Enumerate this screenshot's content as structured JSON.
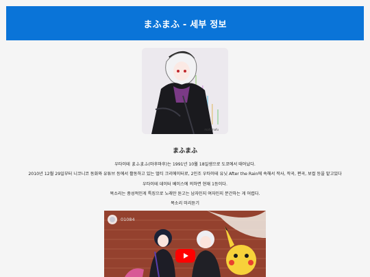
{
  "header": {
    "title": "まふまふ - 세부 정보"
  },
  "profile": {
    "name": "まふまふ",
    "image_caption": "mafumafu"
  },
  "description": {
    "line1": "우타이테 まふまふ(마후마후)는 1991년 10월 18일생으로 도쿄에서 태어났다.",
    "line2": "2010년 12월 29일부터 니코니코 동화와 유튜브 등에서 활동하고 있는 멀티 크리에이터로, 2인조 우타이테 유닛 After the Rain에 속해서 작사, 작곡, 편곡, 보컬 등을 맡고있다",
    "line3": "우타이테 데이터 베이스에 의하면 현재 1등이다.",
    "line4": "목소리는 중성적인게 특징으로 노래만 듣고는 남자인지 여자인지 분간하는 게 어렵다.",
    "preview_label": "목소리 미리듣기"
  },
  "video": {
    "counter": "01084",
    "play_icon": "youtube-play-icon"
  },
  "colors": {
    "header_bg": "#0a74d8",
    "play_button": "#ff0000"
  }
}
